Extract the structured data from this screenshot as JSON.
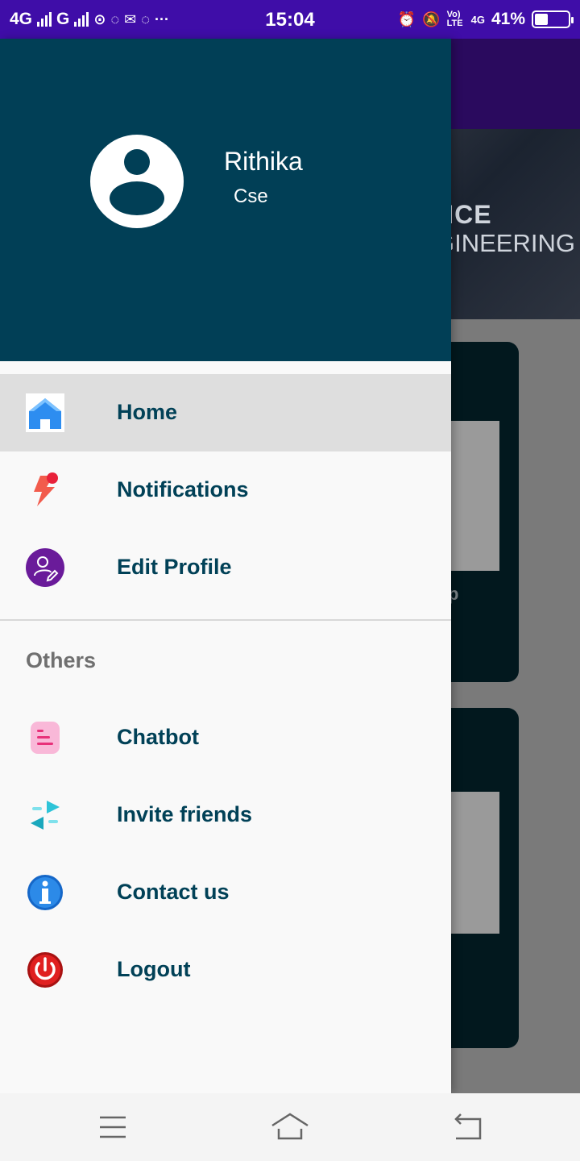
{
  "status_bar": {
    "network_1": "4G",
    "network_2": "G",
    "time": "15:04",
    "volte": "Vo) LTE",
    "network_right": "4G",
    "battery_percent": "41%",
    "battery_level": 0.41,
    "icons": [
      "signal-icon",
      "signal-icon",
      "hotspot-icon",
      "whatsapp-icon",
      "mail-icon",
      "whatsapp-icon",
      "more-icon",
      "alarm-icon",
      "mute-icon",
      "battery-icon"
    ]
  },
  "background": {
    "banner_line1": "NCE",
    "banner_line2": "GINEERING",
    "card_text": "p"
  },
  "drawer": {
    "user": {
      "name": "Rithika",
      "department": "Cse"
    },
    "menu": [
      {
        "label": "Home",
        "icon": "home-icon",
        "active": true
      },
      {
        "label": "Notifications",
        "icon": "notification-icon"
      },
      {
        "label": "Edit Profile",
        "icon": "edit-profile-icon"
      }
    ],
    "section_title": "Others",
    "others": [
      {
        "label": "Chatbot",
        "icon": "chatbot-icon"
      },
      {
        "label": "Invite friends",
        "icon": "invite-icon"
      },
      {
        "label": "Contact us",
        "icon": "info-icon"
      },
      {
        "label": "Logout",
        "icon": "power-icon"
      }
    ]
  },
  "colors": {
    "status_bar": "#3f0da8",
    "drawer_header": "#013f56",
    "menu_text": "#014157",
    "active_row": "#dedede"
  }
}
